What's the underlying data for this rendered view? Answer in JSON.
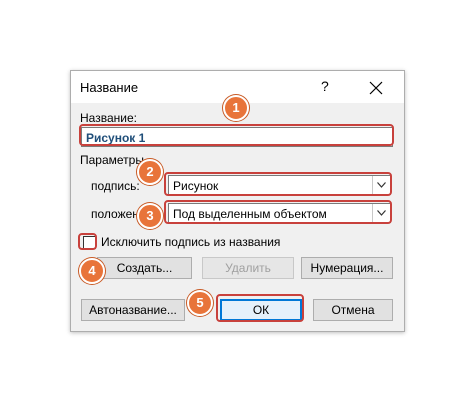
{
  "dialog": {
    "title": "Название",
    "help": "?",
    "close": "X"
  },
  "caption": {
    "label": "Название:",
    "value": "Рисунок 1"
  },
  "params": {
    "group_label": "Параметры",
    "label_label": "подпись:",
    "label_value": "Рисунок",
    "position_label": "положен",
    "position_value": "Под выделенным объектом",
    "exclude_label": "Исключить подпись из названия"
  },
  "buttons": {
    "create": "Создать...",
    "delete": "Удалить",
    "numbering": "Нумерация...",
    "autocaption": "Автоназвание...",
    "ok": "ОК",
    "cancel": "Отмена"
  },
  "badges": [
    "1",
    "2",
    "3",
    "4",
    "5"
  ],
  "colors": {
    "highlight": "#c8413c",
    "badge": "#e8743a",
    "caption_text": "#1f4e79"
  }
}
